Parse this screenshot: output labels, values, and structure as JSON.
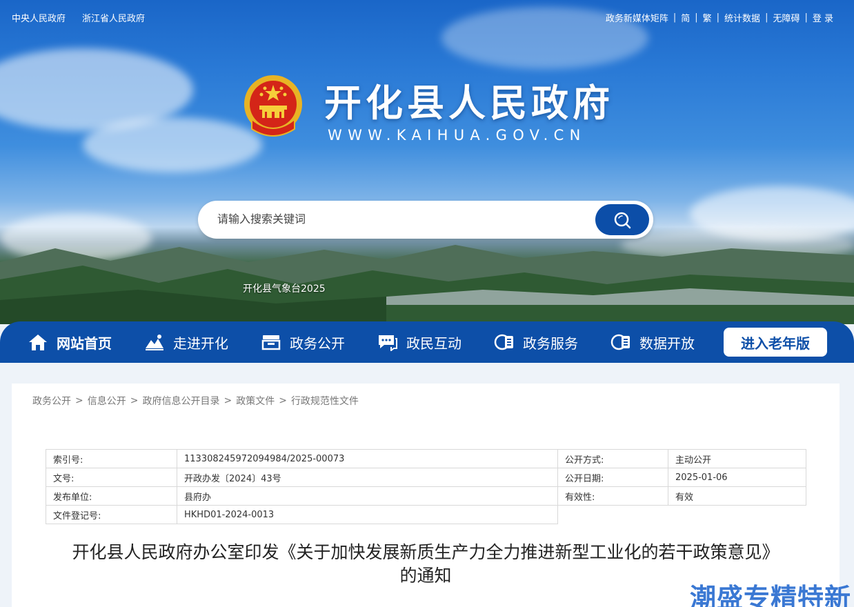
{
  "top_links": {
    "left": [
      "中央人民政府",
      "浙江省人民政府"
    ],
    "right": [
      "政务新媒体矩阵",
      "简",
      "繁",
      "统计数据",
      "无障碍",
      "登 录"
    ]
  },
  "header": {
    "title": "开化县人民政府",
    "url": "WWW.KAIHUA.GOV.CN",
    "banner_caption": "开化县气象台2025"
  },
  "search": {
    "placeholder": "请输入搜索关键词",
    "icon": "search-icon"
  },
  "nav": {
    "items": [
      {
        "label": "网站首页",
        "icon": "home-icon"
      },
      {
        "label": "走进开化",
        "icon": "landscape-icon"
      },
      {
        "label": "政务公开",
        "icon": "inbox-icon"
      },
      {
        "label": "政民互动",
        "icon": "chat-icon"
      },
      {
        "label": "政务服务",
        "icon": "service-icon"
      },
      {
        "label": "数据开放",
        "icon": "data-icon"
      }
    ],
    "elder_button": "进入老年版"
  },
  "breadcrumb": [
    "政务公开",
    "信息公开",
    "政府信息公开目录",
    "政策文件",
    "行政规范性文件"
  ],
  "breadcrumb_sep": ">",
  "meta": {
    "rows": [
      {
        "k1": "索引号:",
        "v1": "113308245972094984/2025-00073",
        "k2": "公开方式:",
        "v2": "主动公开"
      },
      {
        "k1": "文号:",
        "v1": "开政办发〔2024〕43号",
        "k2": "公开日期:",
        "v2": "2025-01-06"
      },
      {
        "k1": "发布单位:",
        "v1": "县府办",
        "k2": "有效性:",
        "v2": "有效"
      },
      {
        "k1": "文件登记号:",
        "v1": "HKHD01-2024-0013"
      }
    ]
  },
  "document": {
    "title_line1": "开化县人民政府办公室印发《关于加快发展新质生产力全力推进新型工业化的若干政策意见》",
    "title_line2": "的通知"
  },
  "watermark": "潮盛专精特新",
  "colors": {
    "nav": "#0d4fa8",
    "accent": "#0c4ea8",
    "watermark": "#2a6dd0"
  }
}
